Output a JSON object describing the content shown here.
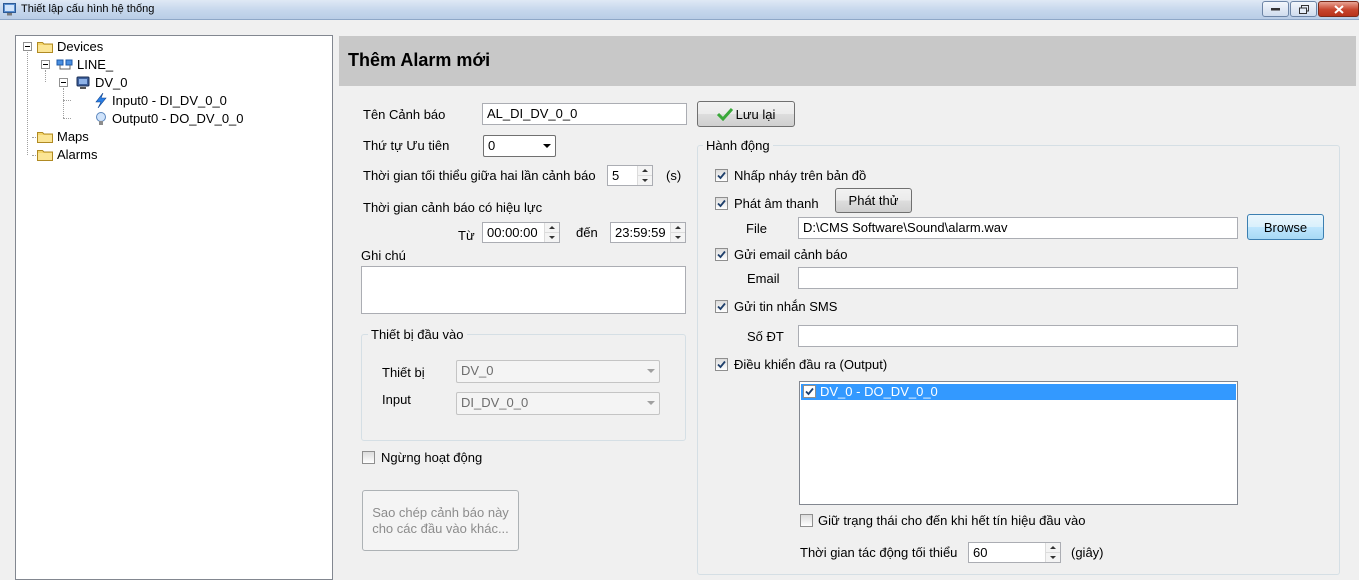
{
  "window": {
    "title": "Thiết lập cấu hình hệ thống",
    "ghost_text": ""
  },
  "tree": {
    "root_devices": "Devices",
    "line": "LINE_",
    "device": "DV_0",
    "input": "Input0 - DI_DV_0_0",
    "output": "Output0 - DO_DV_0_0",
    "maps": "Maps",
    "alarms": "Alarms"
  },
  "header": {
    "title": "Thêm Alarm mới"
  },
  "form": {
    "name_label": "Tên Cảnh báo",
    "name_value": "AL_DI_DV_0_0",
    "save_label": "Lưu lại",
    "priority_label": "Thứ tự Ưu tiên",
    "priority_value": "0",
    "min_interval_label": "Thời gian tối thiểu giữa hai lần cảnh báo",
    "min_interval_value": "5",
    "min_interval_unit": "(s)",
    "valid_time_label": "Thời gian cảnh báo có hiệu lực",
    "from_label": "Từ",
    "from_value": "00:00:00",
    "to_label": "đến",
    "to_value": "23:59:59",
    "note_label": "Ghi chú",
    "note_value": "",
    "input_group_title": "Thiết bị đầu vào",
    "device_label": "Thiết bị",
    "device_value": "DV_0",
    "input_label": "Input",
    "input_value": "DI_DV_0_0",
    "disable_label": "Ngừng hoạt động",
    "copy_button_line1": "Sao chép cảnh báo này",
    "copy_button_line2": "cho các đầu vào khác..."
  },
  "actions": {
    "group_title": "Hành động",
    "blink_label": "Nhấp nháy trên bản đồ",
    "sound_label": "Phát âm thanh",
    "play_button": "Phát thử",
    "file_label": "File",
    "file_value": "D:\\CMS Software\\Sound\\alarm.wav",
    "browse_button": "Browse",
    "email_check_label": "Gửi email cảnh báo",
    "email_label": "Email",
    "email_value": "",
    "sms_check_label": "Gửi tin nhắn SMS",
    "phone_label": "Số ĐT",
    "phone_value": "",
    "output_check_label": "Điều khiển đầu ra (Output)",
    "output_items": [
      "DV_0 - DO_DV_0_0"
    ],
    "hold_label": "Giữ trạng thái cho đến khi hết tín hiệu đầu vào",
    "min_act_label": "Thời gian tác động tối thiểu",
    "min_act_value": "60",
    "min_act_unit": "(giây)"
  },
  "colors": {
    "header_bg": "#c8c8c8",
    "selection": "#3399ff",
    "window_bg": "#f0f0f0"
  }
}
